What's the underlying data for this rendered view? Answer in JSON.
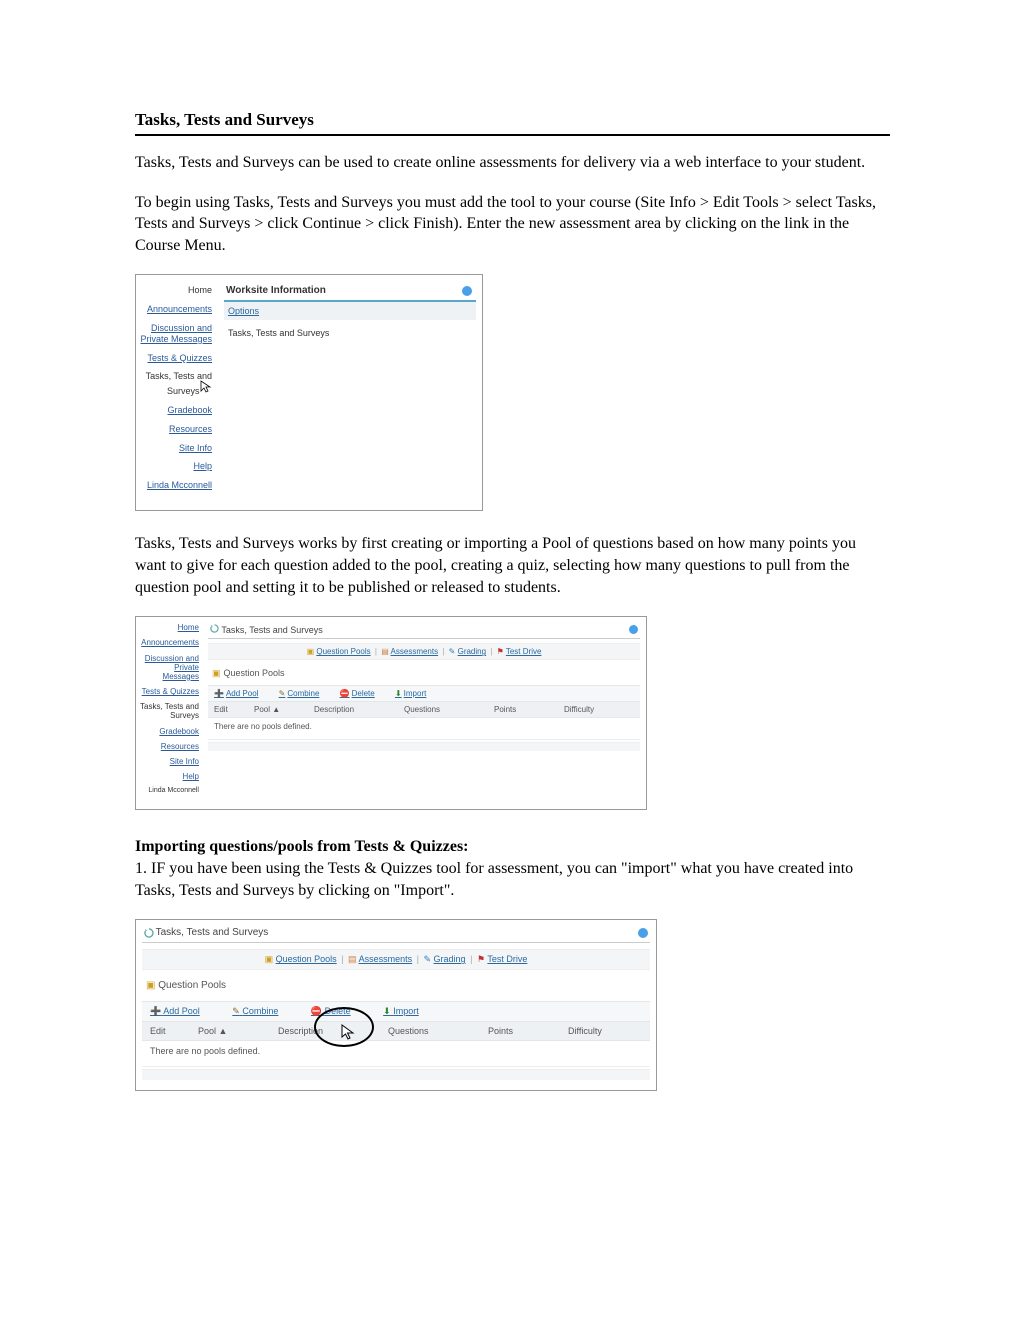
{
  "doc": {
    "title": "Tasks, Tests and Surveys",
    "p1": "Tasks, Tests and Surveys can be used to create online assessments for delivery via a web interface to your student.",
    "p2": "To begin using Tasks, Tests and Surveys you must add the tool to your course (Site Info > Edit Tools > select Tasks, Tests and Surveys > click Continue > click Finish). Enter the new assessment area by clicking on the link in the Course Menu.",
    "p3": "Tasks, Tests and Surveys works by first creating or importing a Pool of questions based on how many points you want to give for each question added to the pool, creating a quiz, selecting how many questions to pull from the question pool and setting it to be published or released to students.",
    "sub1": "Importing questions/pools from Tests & Quizzes:",
    "sub1_body": " 1. IF you have been using the Tests & Quizzes tool for assessment, you can \"import\" what you have created into Tasks, Tests and Surveys by clicking on \"Import\"."
  },
  "fig1": {
    "sidebar": {
      "home": "Home",
      "announcements": "Announcements",
      "discussion": "Discussion and Private Messages",
      "tq": "Tests & Quizzes",
      "tts": "Tasks, Tests and Surveys",
      "gradebook": "Gradebook",
      "resources": "Resources",
      "siteinfo": "Site Info",
      "help": "Help",
      "user": "Linda Mcconnell"
    },
    "panel_title": "Worksite Information",
    "options": "Options",
    "site_area": "Tasks, Tests and Surveys"
  },
  "fig2": {
    "sidebar": {
      "home": "Home",
      "announcements": "Announcements",
      "discussion": "Discussion and Private Messages",
      "tq": "Tests & Quizzes",
      "tts": "Tasks, Tests and Surveys",
      "gradebook": "Gradebook",
      "resources": "Resources",
      "siteinfo": "Site Info",
      "help": "Help",
      "user": "Linda Mcconnell"
    },
    "titlebar": "Tasks, Tests and Surveys",
    "nav": {
      "qp": "Question Pools",
      "assess": "Assessments",
      "grading": "Grading",
      "td": "Test Drive"
    },
    "qp_label": "Question Pools",
    "actions": {
      "add": "Add Pool",
      "combine": "Combine",
      "del": "Delete",
      "imp": "Import"
    },
    "cols": {
      "edit": "Edit",
      "pool": "Pool ▲",
      "desc": "Description",
      "q": "Questions",
      "pts": "Points",
      "diff": "Difficulty"
    },
    "empty": "There are no pools defined."
  },
  "fig3": {
    "titlebar": "Tasks, Tests and Surveys",
    "nav": {
      "qp": "Question Pools",
      "assess": "Assessments",
      "grading": "Grading",
      "td": "Test Drive"
    },
    "qp_label": "Question Pools",
    "actions": {
      "add": "Add Pool",
      "combine": "Combine",
      "del": "Delete",
      "imp": "Import"
    },
    "cols": {
      "edit": "Edit",
      "pool": "Pool ▲",
      "desc": "Description",
      "q": "Questions",
      "pts": "Points",
      "diff": "Difficulty"
    },
    "empty": "There are no pools defined."
  }
}
